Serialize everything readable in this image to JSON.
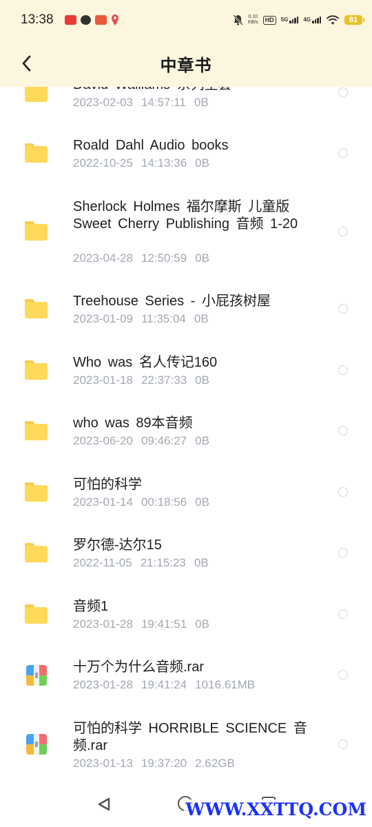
{
  "status_bar": {
    "time": "13:38",
    "net_speed_value": "0.10",
    "net_speed_unit": "KB/s",
    "hd_label": "HD",
    "net1_label": "5G",
    "net2_label": "4G",
    "battery": "81"
  },
  "header": {
    "title": "中章书"
  },
  "files": [
    {
      "name": "David Walliams 系列全套",
      "date": "2023-02-03",
      "time": "14:57:11",
      "size": "0B",
      "type": "folder"
    },
    {
      "name": "Roald Dahl Audio books",
      "date": "2022-10-25",
      "time": "14:13:36",
      "size": "0B",
      "type": "folder"
    },
    {
      "name": "Sherlock Holmes 福尔摩斯 儿童版 Sweet Cherry Publishing 音频 1-20",
      "date": "2023-04-28",
      "time": "12:50:59",
      "size": "0B",
      "type": "folder"
    },
    {
      "name": "Treehouse Series - 小屁孩树屋",
      "date": "2023-01-09",
      "time": "11:35:04",
      "size": "0B",
      "type": "folder"
    },
    {
      "name": "Who was 名人传记160",
      "date": "2023-01-18",
      "time": "22:37:33",
      "size": "0B",
      "type": "folder"
    },
    {
      "name": "who was 89本音频",
      "date": "2023-06-20",
      "time": "09:46:27",
      "size": "0B",
      "type": "folder"
    },
    {
      "name": "可怕的科学",
      "date": "2023-01-14",
      "time": "00:18:56",
      "size": "0B",
      "type": "folder"
    },
    {
      "name": "罗尔德-达尔15",
      "date": "2022-11-05",
      "time": "21:15:23",
      "size": "0B",
      "type": "folder"
    },
    {
      "name": "音频1",
      "date": "2023-01-28",
      "time": "19:41:51",
      "size": "0B",
      "type": "folder"
    },
    {
      "name": "十万个为什么音频.rar",
      "date": "2023-01-28",
      "time": "19:41:24",
      "size": "1016.61MB",
      "type": "archive"
    },
    {
      "name": "可怕的科学 HORRIBLE SCIENCE 音频.rar",
      "date": "2023-01-13",
      "time": "19:37:20",
      "size": "2.62GB",
      "type": "archive"
    }
  ],
  "watermark": "WWW.XXTTQ.COM",
  "colors": {
    "header_bg": "#fdf6de",
    "folder": "#ffd95a",
    "meta_text": "#a2a8b2",
    "watermark": "#1a31ff"
  }
}
